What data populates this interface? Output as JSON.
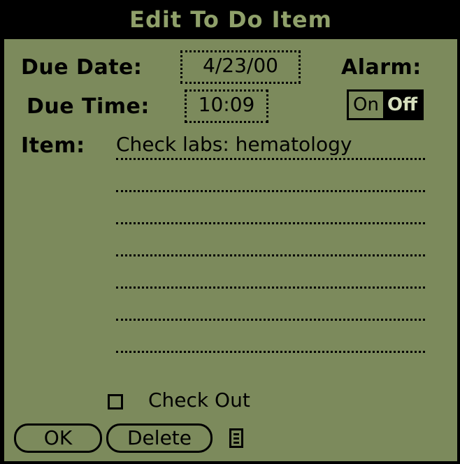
{
  "dialog": {
    "title": "Edit To Do Item"
  },
  "fields": {
    "due_date_label": "Due Date:",
    "due_date_value": "4/23/00",
    "due_time_label": "Due Time:",
    "due_time_value": "10:09",
    "alarm_label": "Alarm:",
    "alarm_options": [
      "On",
      "Off"
    ],
    "alarm_selected": "Off",
    "item_label": "Item:",
    "item_value": "Check labs: hematology"
  },
  "checkout": {
    "label": "Check Out",
    "checked": false
  },
  "buttons": {
    "ok": "OK",
    "delete": "Delete"
  },
  "icons": {
    "note": "note-icon"
  },
  "colors": {
    "background": "#7c8a5c",
    "foreground": "#000000",
    "title_text": "#8fa06a"
  }
}
